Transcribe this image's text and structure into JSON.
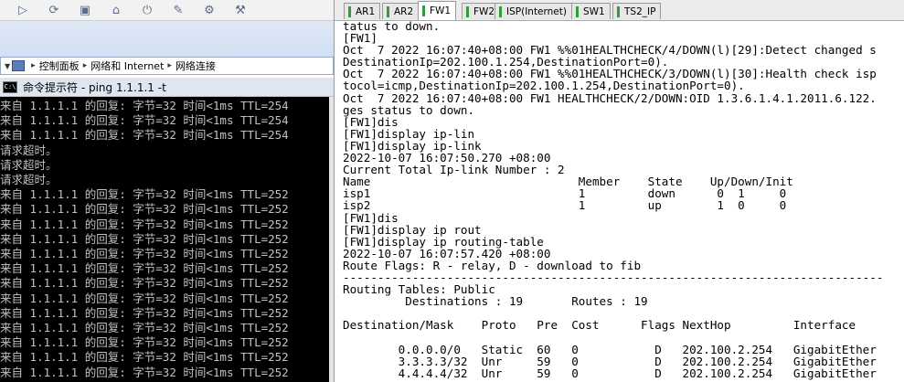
{
  "toolbar": {
    "icons": [
      "play-icon",
      "refresh-icon",
      "stop-icon",
      "home-icon",
      "power-icon",
      "wrench-icon",
      "settings-icon",
      "tools-icon"
    ]
  },
  "addressbar": {
    "crumbs": [
      "控制面板",
      "网络和 Internet",
      "网络连接"
    ]
  },
  "cmd": {
    "title": "命令提示符 - ping  1.1.1.1 -t",
    "icon_text": "C:\\"
  },
  "console_lines": [
    "来自 1.1.1.1 的回复: 字节=32 时间<1ms TTL=254",
    "来自 1.1.1.1 的回复: 字节=32 时间<1ms TTL=254",
    "来自 1.1.1.1 的回复: 字节=32 时间<1ms TTL=254",
    "请求超时。",
    "请求超时。",
    "请求超时。",
    "来自 1.1.1.1 的回复: 字节=32 时间<1ms TTL=252",
    "来自 1.1.1.1 的回复: 字节=32 时间<1ms TTL=252",
    "来自 1.1.1.1 的回复: 字节=32 时间<1ms TTL=252",
    "来自 1.1.1.1 的回复: 字节=32 时间<1ms TTL=252",
    "来自 1.1.1.1 的回复: 字节=32 时间<1ms TTL=252",
    "来自 1.1.1.1 的回复: 字节=32 时间<1ms TTL=252",
    "来自 1.1.1.1 的回复: 字节=32 时间<1ms TTL=252",
    "来自 1.1.1.1 的回复: 字节=32 时间<1ms TTL=252",
    "来自 1.1.1.1 的回复: 字节=32 时间<1ms TTL=252",
    "来自 1.1.1.1 的回复: 字节=32 时间<1ms TTL=252",
    "来自 1.1.1.1 的回复: 字节=32 时间<1ms TTL=252",
    "来自 1.1.1.1 的回复: 字节=32 时间<1ms TTL=252",
    "来自 1.1.1.1 的回复: 字节=32 时间<1ms TTL=252"
  ],
  "tabs": [
    {
      "label": "AR1",
      "active": false
    },
    {
      "label": "AR2",
      "active": false
    },
    {
      "label": "FW1",
      "active": true
    },
    {
      "label": "FW2",
      "active": false
    },
    {
      "label": "ISP(Internet)",
      "active": false
    },
    {
      "label": "SW1",
      "active": false
    },
    {
      "label": "TS2_IP",
      "active": false
    }
  ],
  "terminal_lines": [
    "tatus to down.",
    "[FW1]",
    "Oct  7 2022 16:07:40+08:00 FW1 %%01HEALTHCHECK/4/DOWN(l)[29]:Detect changed s",
    "DestinationIp=202.100.1.254,DestinationPort=0).",
    "Oct  7 2022 16:07:40+08:00 FW1 %%01HEALTHCHECK/3/DOWN(l)[30]:Health check isp",
    "tocol=icmp,DestinationIp=202.100.1.254,DestinationPort=0).",
    "Oct  7 2022 16:07:40+08:00 FW1 HEALTHCHECK/2/DOWN:OID 1.3.6.1.4.1.2011.6.122.",
    "ges status to down.",
    "[FW1]dis",
    "[FW1]display ip-lin",
    "[FW1]display ip-link",
    "2022-10-07 16:07:50.270 +08:00",
    "Current Total Ip-link Number : 2",
    "Name                              Member    State    Up/Down/Init",
    "isp1                              1         down      0  1     0",
    "isp2                              1         up        1  0     0",
    "[FW1]dis",
    "[FW1]display ip rout",
    "[FW1]display ip routing-table",
    "2022-10-07 16:07:57.420 +08:00",
    "Route Flags: R - relay, D - download to fib",
    "------------------------------------------------------------------------------",
    "Routing Tables: Public",
    "         Destinations : 19       Routes : 19",
    "",
    "Destination/Mask    Proto   Pre  Cost      Flags NextHop         Interface",
    "",
    "        0.0.0.0/0   Static  60   0           D   202.100.2.254   GigabitEther",
    "        3.3.3.3/32  Unr     59   0           D   202.100.2.254   GigabitEther",
    "        4.4.4.4/32  Unr     59   0           D   202.100.2.254   GigabitEther"
  ]
}
